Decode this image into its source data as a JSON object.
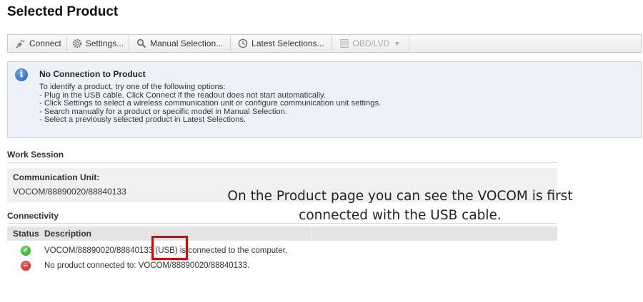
{
  "page_title": "Selected Product",
  "toolbar": {
    "connect": "Connect",
    "settings": "Settings...",
    "manual_selection": "Manual Selection...",
    "latest_selections": "Latest Selections...",
    "obd_lvd": "OBD/LVD"
  },
  "info": {
    "title": "No Connection to Product",
    "lines": [
      "To identify a product, try one of the following options:",
      "- Plug in the USB cable. Click Connect if the readout does not start automatically.",
      "- Click Settings to select a wireless communication unit or configure communication unit settings.",
      "- Search manually for a product or specific model in Manual Selection.",
      "- Select a previously selected product in Latest Selections."
    ]
  },
  "work_session": {
    "label": "Work Session",
    "comm_unit_label": "Communication Unit:",
    "comm_unit_value": "VOCOM/88890020/88840133"
  },
  "connectivity": {
    "label": "Connectivity",
    "headers": {
      "status": "Status",
      "description": "Description"
    },
    "rows": [
      {
        "status": "ok",
        "description": "VOCOM/88890020/88840133 (USB) is connected to the computer."
      },
      {
        "status": "error",
        "description": "No product connected to: VOCOM/88890020/88840133."
      }
    ]
  },
  "annotation": {
    "line1": "On the Product page you can see the VOCOM is first",
    "line2": "connected with the USB cable."
  },
  "colors": {
    "highlight": "#e00000",
    "ok": "#1e9a1e",
    "error": "#c81414"
  }
}
